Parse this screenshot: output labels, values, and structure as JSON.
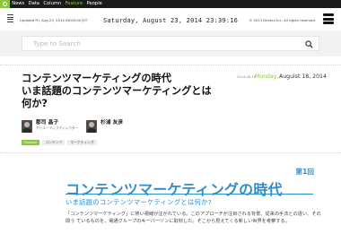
{
  "topnav": {
    "items": [
      {
        "label": "News",
        "active": false
      },
      {
        "label": "Data",
        "active": false
      },
      {
        "label": "Column",
        "active": false
      },
      {
        "label": "Feature",
        "active": true
      },
      {
        "label": "People",
        "active": false
      }
    ]
  },
  "header": {
    "updated": "Updated Fri, Aug 23, 2014 06:00:00 JST",
    "date": "Saturday, August 23, 2014 23:39:16",
    "copyright": "© 2013 Dentsu Inc. All rights reserved."
  },
  "search": {
    "placeholder": "Type to Search"
  },
  "article": {
    "title_line1": "コンテンツマーケティングの時代",
    "title_line2": "いま話題のコンテンツマーケティングとは",
    "title_line3": "何か?",
    "date_small": "2014.08.18",
    "pub_day": "Monday,",
    "pub_date": "Auguist 18, 2014",
    "authors": [
      {
        "name": "郡司 晶子",
        "role": "クリエーティブディレクター"
      },
      {
        "name": "杉浦 友彦",
        "role": ""
      }
    ],
    "tags": [
      "Feature",
      "コンテンツ",
      "マーケティング"
    ]
  },
  "hero": {
    "series": "第1回",
    "title": "コンテンツマーケティングの時代",
    "subtitle": "いま話題のコンテンツマーケティングとは何か?",
    "body": "「コンテンツマーケティング」に熱い視線が注がれている。このアプローチが注目される背景、従来の手法との違い、その問う ているものを、電通グループのキーパーソンに取材した。そこから見えてくる新しい世界を考察する。"
  },
  "colors": {
    "accent_green": "#8cc63f",
    "accent_blue": "#2e8ec9",
    "nav_bg": "#1b1b1b"
  }
}
